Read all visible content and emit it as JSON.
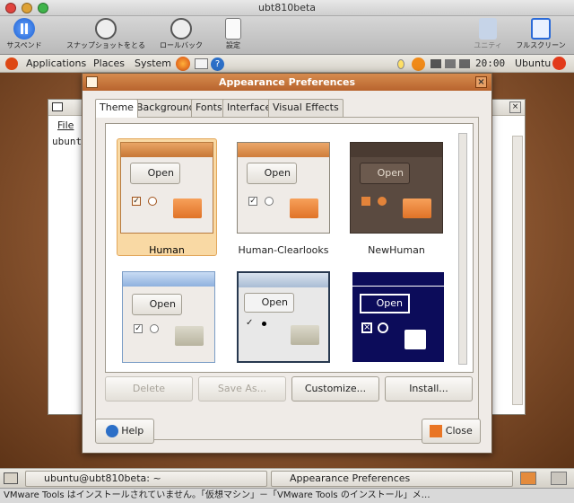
{
  "window_title": "ubt810beta",
  "toolbar": {
    "suspend": "サスペンド",
    "snapshot": "スナップショットをとる",
    "rollback": "ロールバック",
    "settings": "設定",
    "unity": "ユニティ",
    "fullscreen": "フルスクリーン"
  },
  "panel": {
    "applications": "Applications",
    "places": "Places",
    "system": "System",
    "clock": "20:00",
    "user": "Ubuntu"
  },
  "terminal": {
    "menu_file": "File",
    "prompt": "ubunt"
  },
  "dialog": {
    "title": "Appearance Preferences",
    "tabs": [
      "Theme",
      "Background",
      "Fonts",
      "Interface",
      "Visual Effects"
    ],
    "themes": [
      {
        "name": "Human",
        "open": "Open"
      },
      {
        "name": "Human-Clearlooks",
        "open": "Open"
      },
      {
        "name": "NewHuman",
        "open": "Open"
      },
      {
        "name": "",
        "open": "Open"
      },
      {
        "name": "",
        "open": "Open"
      },
      {
        "name": "",
        "open": "Open"
      }
    ],
    "buttons": {
      "delete": "Delete",
      "save_as": "Save As...",
      "customize": "Customize...",
      "install": "Install..."
    },
    "help": "Help",
    "close": "Close"
  },
  "taskbar": {
    "terminal": "ubuntu@ubt810beta: ~",
    "appearance": "Appearance Preferences"
  },
  "status": "VMware Tools はインストールされていません。「仮想マシン」－「VMware Tools のインストール」メ…"
}
